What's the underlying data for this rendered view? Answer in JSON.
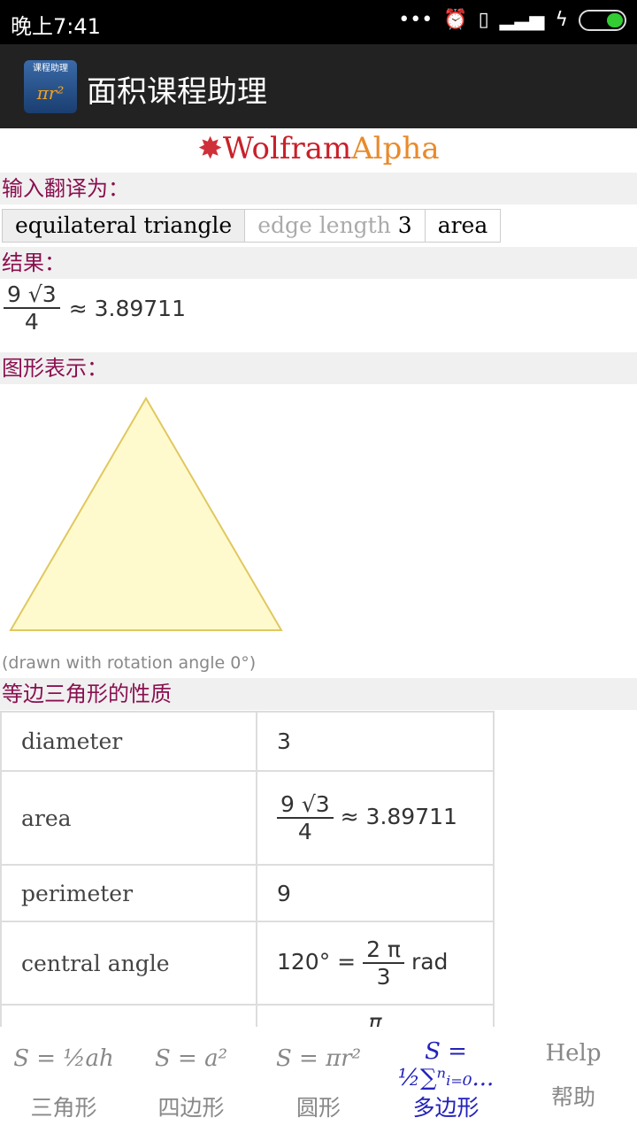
{
  "status_bar": {
    "time": "晚上7:41",
    "icons": [
      "more-dots-icon",
      "alarm-icon",
      "usb-icon",
      "signal-icon",
      "charging-icon",
      "battery-icon"
    ]
  },
  "app_bar": {
    "icon_text": "课程助理",
    "icon_formula": "πr²",
    "title": "面积课程助理"
  },
  "logo": {
    "part1": "Wolfram",
    "part2": "Alpha"
  },
  "input_section": {
    "header": "输入翻译为：",
    "chips": [
      "equilateral triangle",
      "edge length",
      "3",
      "area"
    ]
  },
  "result_section": {
    "header": "结果：",
    "numerator": "9 √3",
    "denominator": "4",
    "approx": "≈ 3.89711"
  },
  "graphic_section": {
    "header": "图形表示：",
    "caption": "(drawn with rotation angle 0°)",
    "fill_color": "#fffacd",
    "stroke_color": "#e0c860"
  },
  "properties_section": {
    "header": "等边三角形的性质",
    "rows": [
      {
        "key": "diameter",
        "value": "3"
      },
      {
        "key": "area",
        "numerator": "9 √3",
        "denominator": "4",
        "approx": "≈ 3.89711"
      },
      {
        "key": "perimeter",
        "value": "9"
      },
      {
        "key": "central angle",
        "prefix": "120° =",
        "numerator": "2 π",
        "denominator": "3",
        "suffix": "rad"
      },
      {
        "key": "",
        "value": "π"
      }
    ]
  },
  "bottom_nav": [
    {
      "formula": "S = ½ah",
      "label": "三角形",
      "active": false
    },
    {
      "formula": "S = a²",
      "label": "四边形",
      "active": false
    },
    {
      "formula": "S = πr²",
      "label": "圆形",
      "active": false
    },
    {
      "formula": "S = ½∑ⁿᵢ₌₀...",
      "label": "多边形",
      "active": true
    },
    {
      "formula": "Help",
      "label": "帮助",
      "active": false
    }
  ]
}
